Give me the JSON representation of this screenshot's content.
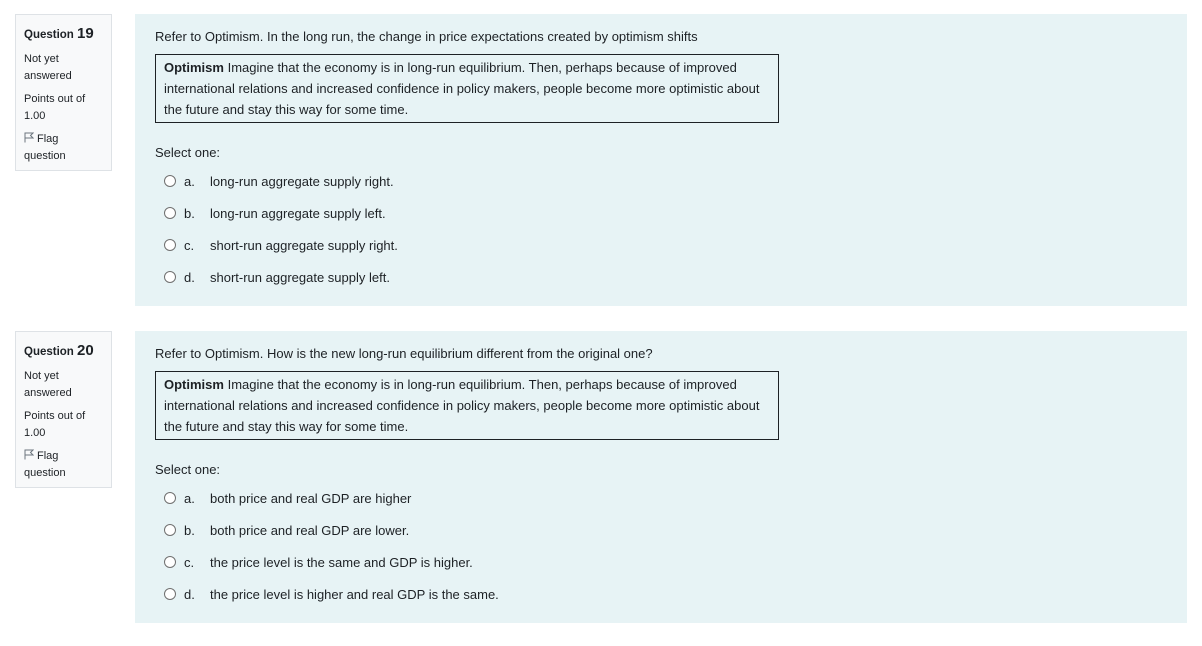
{
  "questions": [
    {
      "label": "Question",
      "number": "19",
      "state": "Not yet answered",
      "grade": "Points out of 1.00",
      "flag": "Flag question",
      "text": "Refer to Optimism. In the long run, the change in price expectations created by optimism shifts",
      "scenario_title": "Optimism",
      "scenario_text": " Imagine that the economy is in long-run equilibrium. Then, perhaps because of improved international relations and increased confidence in policy makers, people become more optimistic about the future and stay this way for some time.",
      "prompt": "Select one:",
      "answers": [
        {
          "letter": "a.",
          "text": "long-run aggregate supply right."
        },
        {
          "letter": "b.",
          "text": "long-run aggregate supply left."
        },
        {
          "letter": "c.",
          "text": "short-run aggregate supply right."
        },
        {
          "letter": "d.",
          "text": "short-run aggregate supply left."
        }
      ]
    },
    {
      "label": "Question",
      "number": "20",
      "state": "Not yet answered",
      "grade": "Points out of 1.00",
      "flag": "Flag question",
      "text": "Refer to Optimism. How is the new long-run equilibrium different from the original one?",
      "scenario_title": "Optimism",
      "scenario_text": " Imagine that the economy is in long-run equilibrium. Then, perhaps because of improved international relations and increased confidence in policy makers, people become more optimistic about the future and stay this way for some time.",
      "prompt": "Select one:",
      "answers": [
        {
          "letter": "a.",
          "text": "both price and real GDP are higher"
        },
        {
          "letter": "b.",
          "text": "both price and real GDP are lower."
        },
        {
          "letter": "c.",
          "text": "the price level is the same and GDP is higher."
        },
        {
          "letter": "d.",
          "text": "the price level is higher and real GDP is the same."
        }
      ]
    }
  ]
}
